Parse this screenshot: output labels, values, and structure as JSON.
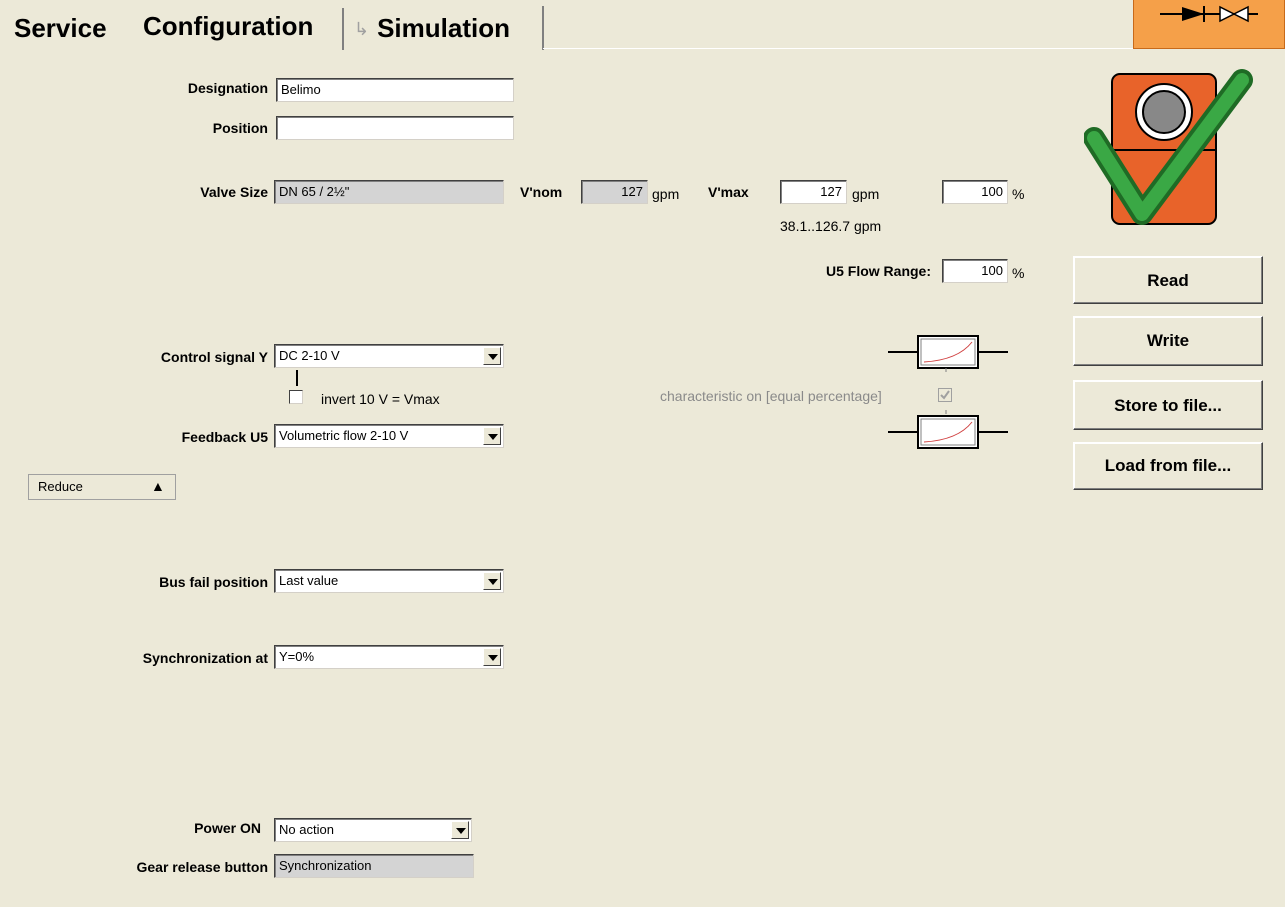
{
  "tabs": {
    "service": "Service",
    "configuration": "Configuration",
    "simulation": "Simulation"
  },
  "form": {
    "designation": {
      "label": "Designation",
      "value": "Belimo"
    },
    "position": {
      "label": "Position",
      "value": ""
    },
    "valve_size": {
      "label": "Valve Size",
      "value": "DN 65 / 2½\""
    },
    "vnom": {
      "label": "V'nom",
      "value": "127",
      "unit": "gpm"
    },
    "vmax": {
      "label": "V'max",
      "value": "127",
      "unit": "gpm",
      "range": "38.1..126.7 gpm"
    },
    "vmax_percent": {
      "value": "100",
      "unit": "%"
    },
    "u5_flow_range": {
      "label": "U5 Flow Range:",
      "value": "100",
      "unit": "%"
    },
    "control_signal": {
      "label": "Control signal Y",
      "value": "DC 2-10 V"
    },
    "invert": {
      "label": "invert 10 V = Vmax"
    },
    "characteristic": {
      "label": "characteristic on [equal percentage]"
    },
    "feedback_u5": {
      "label": "Feedback U5",
      "value": "Volumetric flow 2-10 V"
    },
    "reduce": {
      "label": "Reduce",
      "arrow": "▲"
    },
    "bus_fail": {
      "label": "Bus fail position",
      "value": "Last value"
    },
    "synchronization": {
      "label": "Synchronization at",
      "value": "Y=0%"
    },
    "power_on": {
      "label": "Power ON",
      "value": "No action"
    },
    "gear_release": {
      "label": "Gear release button",
      "value": "Synchronization"
    }
  },
  "actions": {
    "read": "Read",
    "write": "Write",
    "store": "Store to file...",
    "load": "Load from file..."
  },
  "colors": {
    "background": "#ece9d8",
    "accent_orange": "#f5a049",
    "device_orange": "#e8632a",
    "check_green": "#3aa845"
  }
}
